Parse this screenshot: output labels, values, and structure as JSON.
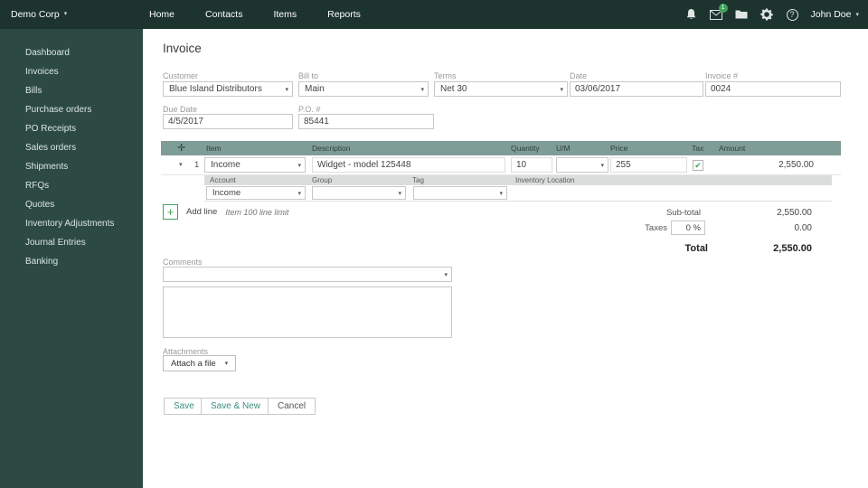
{
  "icons": {
    "caret": "▾",
    "check": "✔",
    "move": "✛",
    "plus": "+",
    "help": "?"
  },
  "navbar": {
    "company": "Demo Corp",
    "items": [
      "Home",
      "Contacts",
      "Items",
      "Reports"
    ],
    "badge": "1",
    "user": "John Doe"
  },
  "sidebar": {
    "items": [
      "Dashboard",
      "Invoices",
      "Bills",
      "Purchase orders",
      "PO Receipts",
      "Sales orders",
      "Shipments",
      "RFQs",
      "Quotes",
      "Inventory Adjustments",
      "Journal Entries",
      "Banking"
    ]
  },
  "page": {
    "title": "Invoice",
    "fields": {
      "customer": {
        "label": "Customer",
        "value": "Blue Island Distributors"
      },
      "bill_to": {
        "label": "Bill to",
        "value": "Main"
      },
      "terms": {
        "label": "Terms",
        "value": "Net 30"
      },
      "date": {
        "label": "Date",
        "value": "03/06/2017"
      },
      "invoice_no": {
        "label": "Invoice #",
        "value": "0024"
      },
      "due_date": {
        "label": "Due Date",
        "value": "4/5/2017"
      },
      "po_no": {
        "label": "P.O. #",
        "value": "85441"
      }
    },
    "table": {
      "headers": [
        "Item",
        "Description",
        "Quantity",
        "U/M",
        "Price",
        "Tax",
        "Amount"
      ],
      "row": {
        "num": "1",
        "item": "Income",
        "description": "Widget - model 125448",
        "quantity": "10",
        "uom": "",
        "price": "255",
        "amount": "2,550.00"
      },
      "subheaders": [
        "Account",
        "Group",
        "Tag",
        "Inventory Location"
      ],
      "subrow": {
        "account": "Income",
        "group": "",
        "tag": ""
      }
    },
    "add_line": {
      "label": "Add line",
      "hint": "Item 100 line limit"
    },
    "totals": {
      "subtotal_label": "Sub-total",
      "subtotal": "2,550.00",
      "taxes_label": "Taxes",
      "tax_rate": "0 %",
      "tax_amount": "0.00",
      "total_label": "Total",
      "total": "2,550.00"
    },
    "comments": {
      "label": "Comments"
    },
    "attachments": {
      "label": "Attachments",
      "button": "Attach a file"
    },
    "actions": {
      "save": "Save",
      "save_new": "Save & New",
      "cancel": "Cancel"
    }
  }
}
